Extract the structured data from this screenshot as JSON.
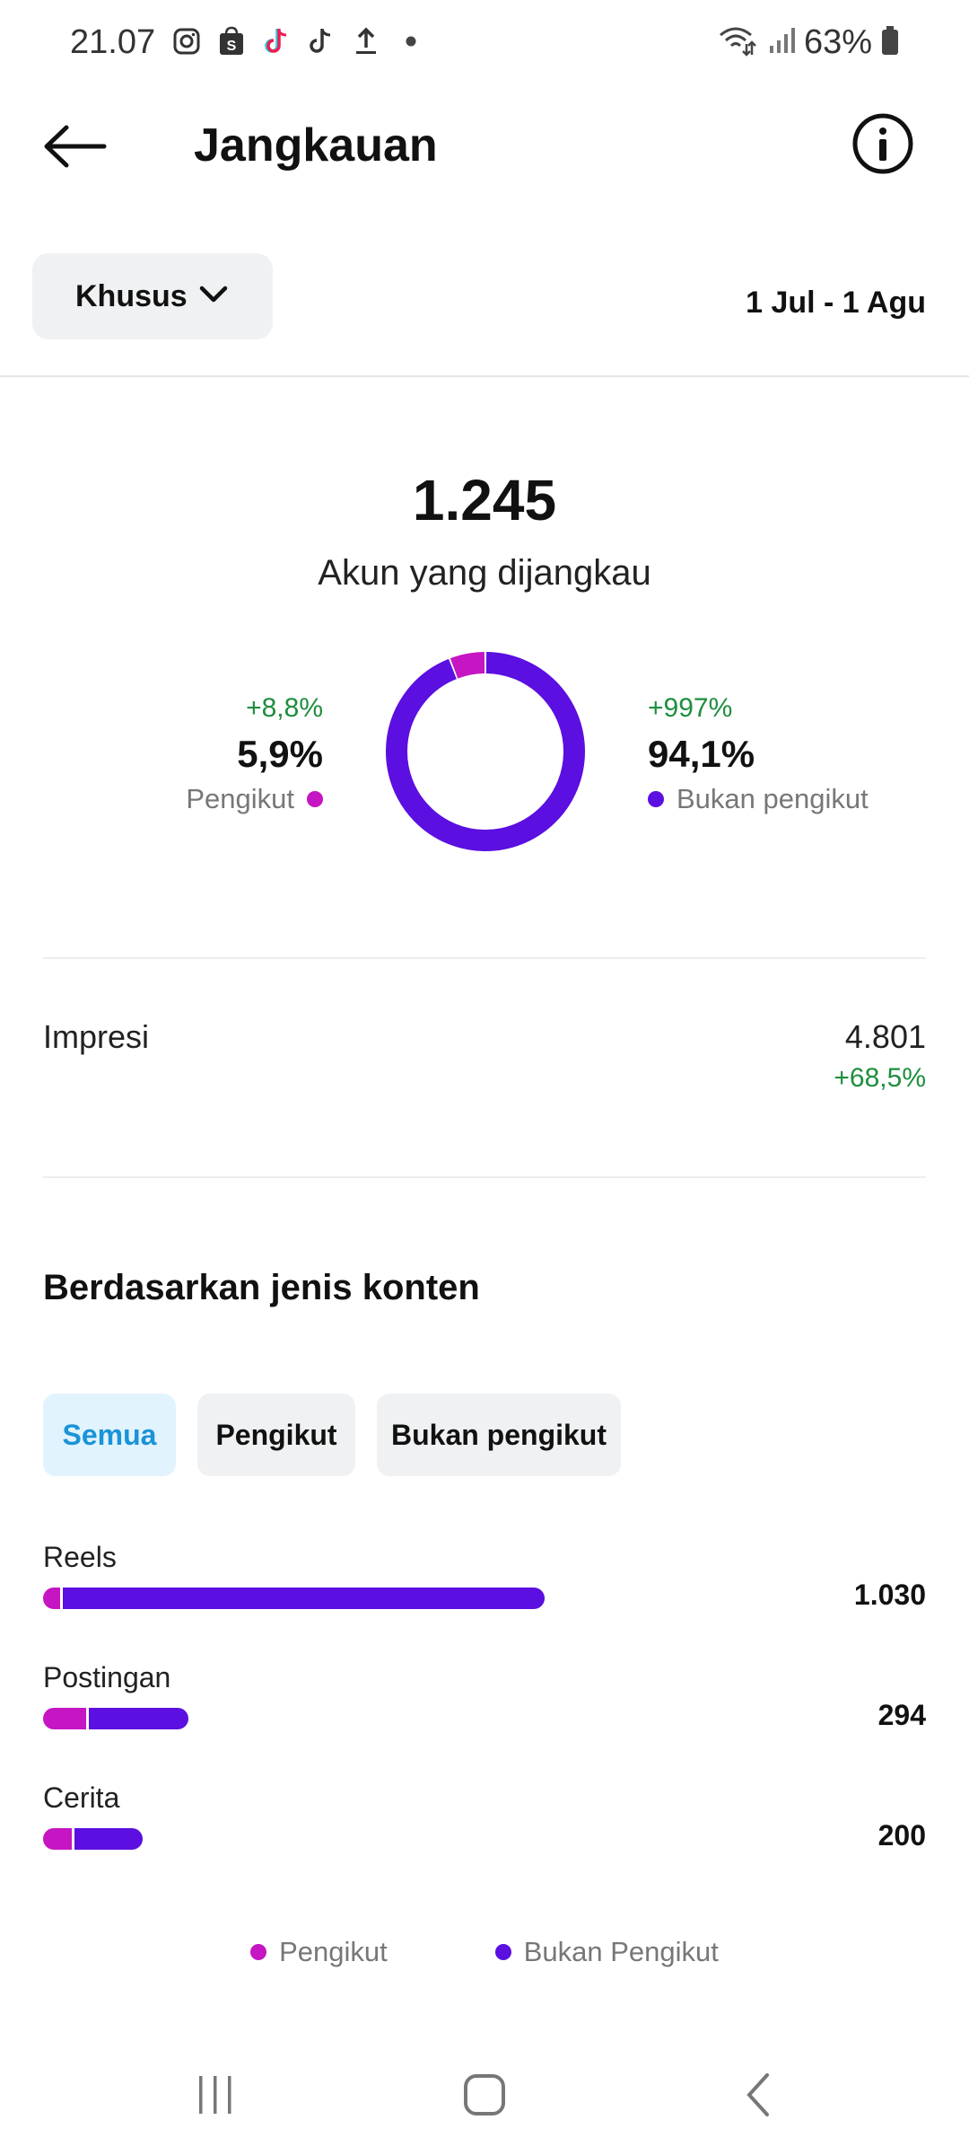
{
  "status_bar": {
    "time": "21.07",
    "battery": "63%",
    "left_icons": [
      "instagram-icon",
      "shop-icon",
      "tiktok-icon",
      "tiktok-icon",
      "upload-icon",
      "dot-icon"
    ],
    "right_icons": [
      "wifi-icon",
      "signal-icon",
      "battery-icon"
    ]
  },
  "header": {
    "title": "Jangkauan",
    "back_icon": "arrow-left-icon",
    "info_icon": "info-icon"
  },
  "filter": {
    "label": "Khusus",
    "date_range": "1 Jul - 1 Agu"
  },
  "summary": {
    "reach": "1.245",
    "reach_label": "Akun yang dijangkau",
    "followers": {
      "change": "+8,8%",
      "percent": "5,9%",
      "label": "Pengikut"
    },
    "non_followers": {
      "change": "+997%",
      "percent": "94,1%",
      "label": "Bukan pengikut"
    }
  },
  "impressions": {
    "label": "Impresi",
    "value": "4.801",
    "change": "+68,5%"
  },
  "content_type": {
    "title": "Berdasarkan jenis konten",
    "tabs": [
      "Semua",
      "Pengikut",
      "Bukan pengikut"
    ],
    "active_tab": "Semua"
  },
  "chart_data": [
    {
      "type": "pie",
      "categories": [
        "Pengikut",
        "Bukan pengikut"
      ],
      "values": [
        5.9,
        94.1
      ],
      "colors": [
        "#c615c2",
        "#5b0fe0"
      ]
    },
    {
      "type": "bar",
      "categories": [
        "Reels",
        "Postingan",
        "Cerita"
      ],
      "value_labels": [
        "1.030",
        "294",
        "200"
      ],
      "series": [
        {
          "name": "Pengikut",
          "values": [
            35,
            88,
            60
          ]
        },
        {
          "name": "Bukan Pengikut",
          "values": [
            995,
            206,
            140
          ]
        }
      ],
      "totals": [
        1030,
        294,
        200
      ],
      "legend": [
        "Pengikut",
        "Bukan Pengikut"
      ]
    }
  ],
  "colors": {
    "followers": "#c615c2",
    "non_followers": "#5b0fe0",
    "positive": "#1e8e3e",
    "active_tab_bg": "#e1f3fd",
    "active_tab_text": "#1a93d8"
  },
  "nav_bar": [
    "recent-apps-icon",
    "home-icon",
    "back-icon"
  ]
}
